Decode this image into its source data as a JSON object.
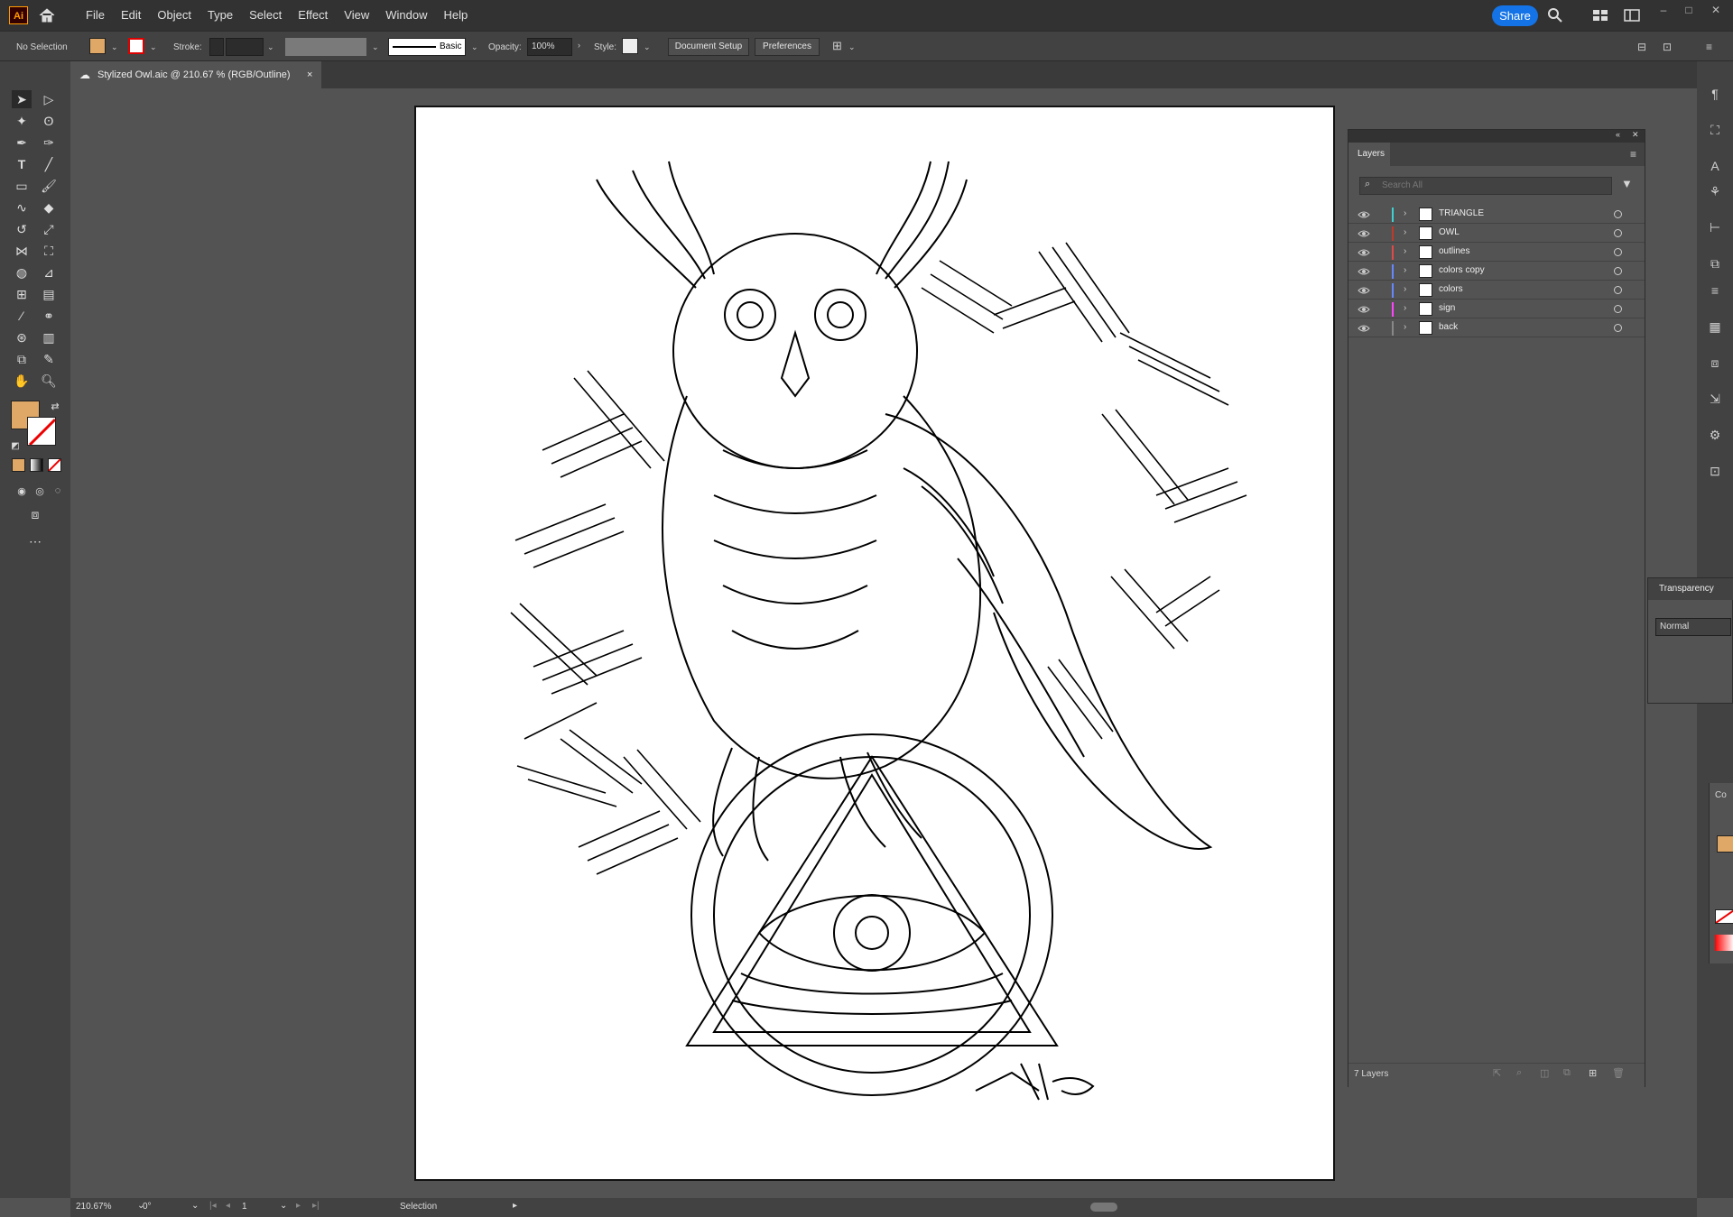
{
  "app": {
    "logo": "Ai"
  },
  "menu": [
    "File",
    "Edit",
    "Object",
    "Type",
    "Select",
    "Effect",
    "View",
    "Window",
    "Help"
  ],
  "share_label": "Share",
  "control": {
    "selection": "No Selection",
    "stroke_label": "Stroke:",
    "brush_label": "Basic",
    "opacity_label": "Opacity:",
    "opacity_value": "100%",
    "style_label": "Style:",
    "doc_setup": "Document Setup",
    "preferences": "Preferences"
  },
  "document_tab": {
    "title": "Stylized Owl.aic @ 210.67 % (RGB/Outline)",
    "close": "×"
  },
  "colors": {
    "fill": "#e0a866",
    "accent": "#1473e6"
  },
  "layers_panel": {
    "tab": "Layers",
    "search_placeholder": "Search All",
    "footer": "7 Layers",
    "layers": [
      {
        "name": "TRIANGLE",
        "color": "#3fd1d1"
      },
      {
        "name": "OWL",
        "color": "#c0392b"
      },
      {
        "name": "outlines",
        "color": "#e04a4a"
      },
      {
        "name": "colors copy",
        "color": "#6688ff"
      },
      {
        "name": "colors",
        "color": "#6688ff"
      },
      {
        "name": "sign",
        "color": "#ff44ff"
      },
      {
        "name": "back",
        "color": "#888888"
      }
    ]
  },
  "transparency_panel": {
    "title": "Transparency",
    "blend_mode": "Normal"
  },
  "color_panel": {
    "title": "Co"
  },
  "status": {
    "zoom": "210.67%",
    "rotation": "0°",
    "artboard": "1",
    "tool": "Selection"
  }
}
